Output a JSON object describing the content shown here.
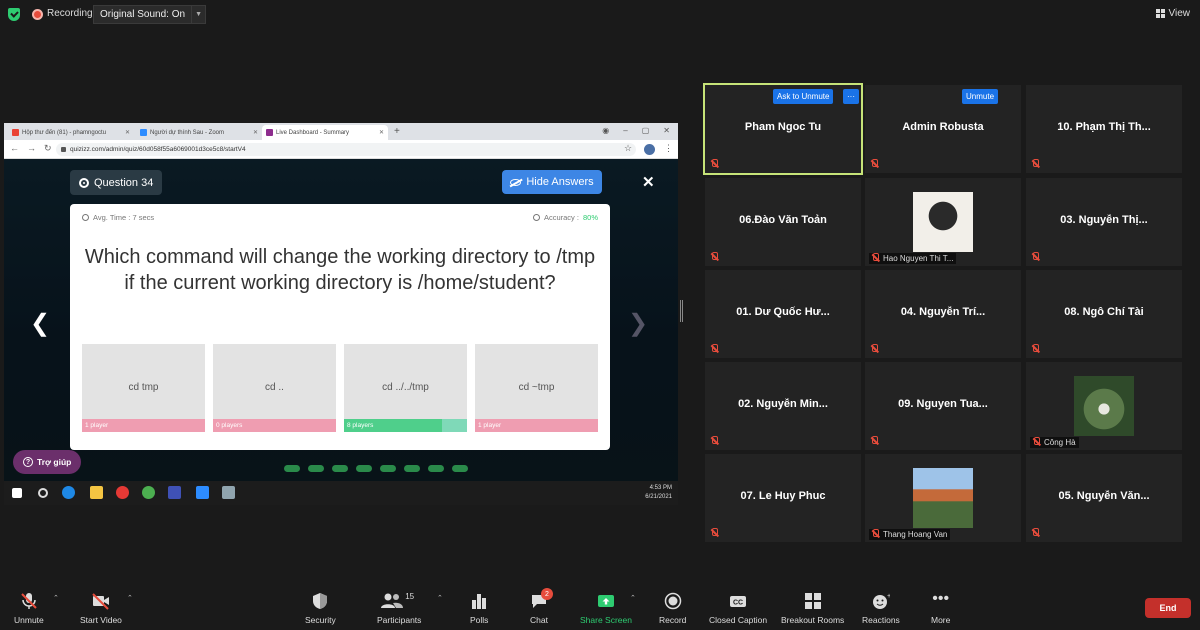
{
  "topbar": {
    "recording_label": "Recording",
    "original_sound": "Original Sound: On",
    "view_label": "View"
  },
  "browser": {
    "tabs": [
      {
        "label": "Hộp thư đến (81) - phamngoctu",
        "fav_color": "#ea4335"
      },
      {
        "label": "Người dự thính Sau - Zoom",
        "fav_color": "#2d8cff"
      },
      {
        "label": "Live Dashboard - Summary",
        "fav_color": "#8e2d8e"
      }
    ],
    "url": "quizizz.com/admin/quiz/60d058f55a6069001d3ce5c8/startV4"
  },
  "quiz": {
    "question_number": "Question 34",
    "hide_answers": "Hide Answers",
    "avg_time": "Avg. Time : 7 secs",
    "accuracy_label": "Accuracy :",
    "accuracy_value": "80%",
    "question": "Which command will change the working directory to /tmp if the current working directory is /home/student?",
    "options": [
      {
        "text": "cd tmp",
        "players": "1 player",
        "correct": false,
        "share": 0.0
      },
      {
        "text": "cd ..",
        "players": "0 players",
        "correct": false,
        "share": 0.0
      },
      {
        "text": "cd ../../tmp",
        "players": "8 players",
        "correct": true,
        "share": 0.8
      },
      {
        "text": "cd ~tmp",
        "players": "1 player",
        "correct": false,
        "share": 0.0
      }
    ],
    "help_label": "Trợ giúp"
  },
  "taskbar": {
    "time": "4:53 PM",
    "date": "6/21/2021"
  },
  "participants": [
    {
      "name": "Pham Ngoc Tu",
      "speaking": true,
      "button": "Ask to Unmute"
    },
    {
      "name": "Admin Robusta",
      "button": "Unmute"
    },
    {
      "name": "10. Phạm Thị Th..."
    },
    {
      "name": "06.Đào Văn Toản"
    },
    {
      "name": "Hao Nguyen Thi T...",
      "photo": true
    },
    {
      "name": "03. Nguyễn Thị..."
    },
    {
      "name": "01. Dư Quốc Hư..."
    },
    {
      "name": "04. Nguyễn Trí..."
    },
    {
      "name": "08. Ngô Chí Tài"
    },
    {
      "name": "02. Nguyễn Min..."
    },
    {
      "name": "09. Nguyen Tua..."
    },
    {
      "name": "Công Hà",
      "photo": true
    },
    {
      "name": "07. Le Huy Phuc"
    },
    {
      "name": "Thang Hoang Van",
      "photo": true
    },
    {
      "name": "05. Nguyễn Văn..."
    }
  ],
  "toolbar": {
    "unmute": "Unmute",
    "start_video": "Start Video",
    "security": "Security",
    "participants": "Participants",
    "participants_count": "15",
    "polls": "Polls",
    "chat": "Chat",
    "chat_badge": "2",
    "share_screen": "Share Screen",
    "record": "Record",
    "closed_caption": "Closed Caption",
    "breakout_rooms": "Breakout Rooms",
    "reactions": "Reactions",
    "more": "More",
    "end": "End"
  },
  "colors": {
    "accent_blue": "#1a73e8",
    "speaking_border": "#c6e378",
    "end_red": "#c4302b",
    "share_green": "#2ecc71"
  }
}
